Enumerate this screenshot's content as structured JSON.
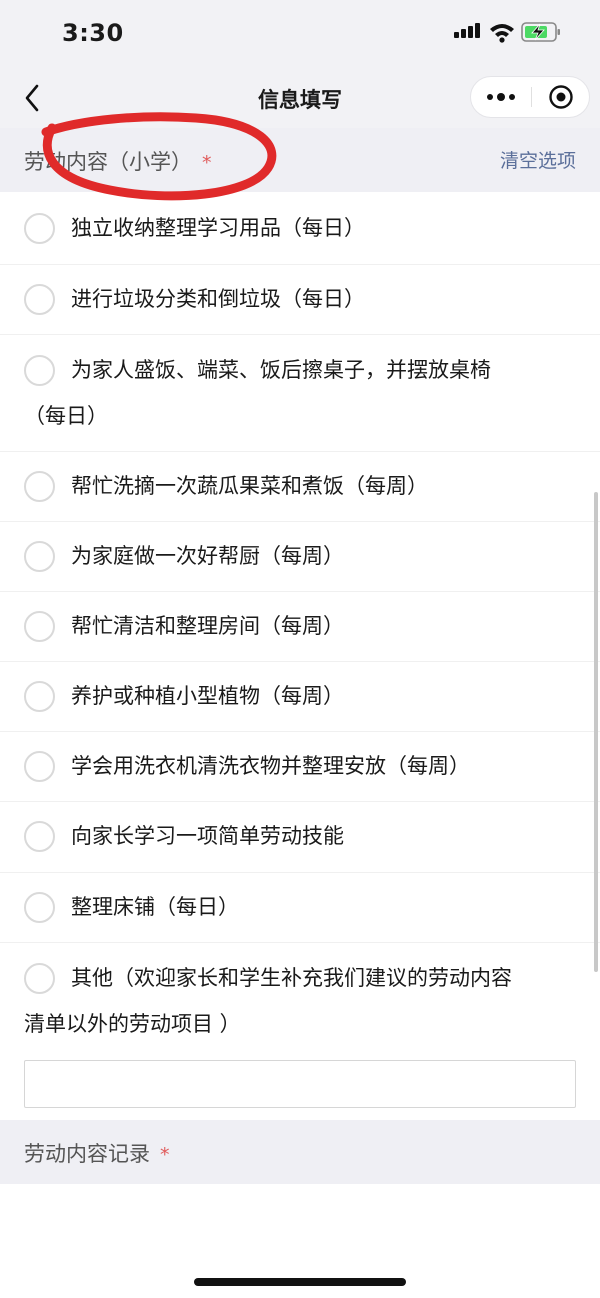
{
  "status_bar": {
    "time": "3:30"
  },
  "nav": {
    "title": "信息填写"
  },
  "section1": {
    "title": "劳动内容（小学）",
    "required_mark": "*",
    "clear_label": "清空选项"
  },
  "options": [
    {
      "label": "独立收纳整理学习用品（每日）"
    },
    {
      "label": "进行垃圾分类和倒垃圾（每日）"
    },
    {
      "label": "为家人盛饭、端菜、饭后擦桌子，并摆放桌椅",
      "label_cont": "（每日）"
    },
    {
      "label": "帮忙洗摘一次蔬瓜果菜和煮饭（每周）"
    },
    {
      "label": "为家庭做一次好帮厨（每周）"
    },
    {
      "label": "帮忙清洁和整理房间（每周）"
    },
    {
      "label": "养护或种植小型植物（每周）"
    },
    {
      "label": "学会用洗衣机清洗衣物并整理安放（每周）"
    },
    {
      "label": "向家长学习一项简单劳动技能"
    },
    {
      "label": "整理床铺（每日）"
    },
    {
      "label": "其他（欢迎家长和学生补充我们建议的劳动内容",
      "label_cont": "清单以外的劳动项目 ）"
    }
  ],
  "other_input": {
    "value": "",
    "placeholder": ""
  },
  "section2": {
    "title": "劳动内容记录",
    "required_mark": "*"
  },
  "colors": {
    "required": "#e05a5a",
    "link": "#5b6f9a",
    "annotation": "#e02a2a",
    "section_bg": "#efeff4"
  }
}
